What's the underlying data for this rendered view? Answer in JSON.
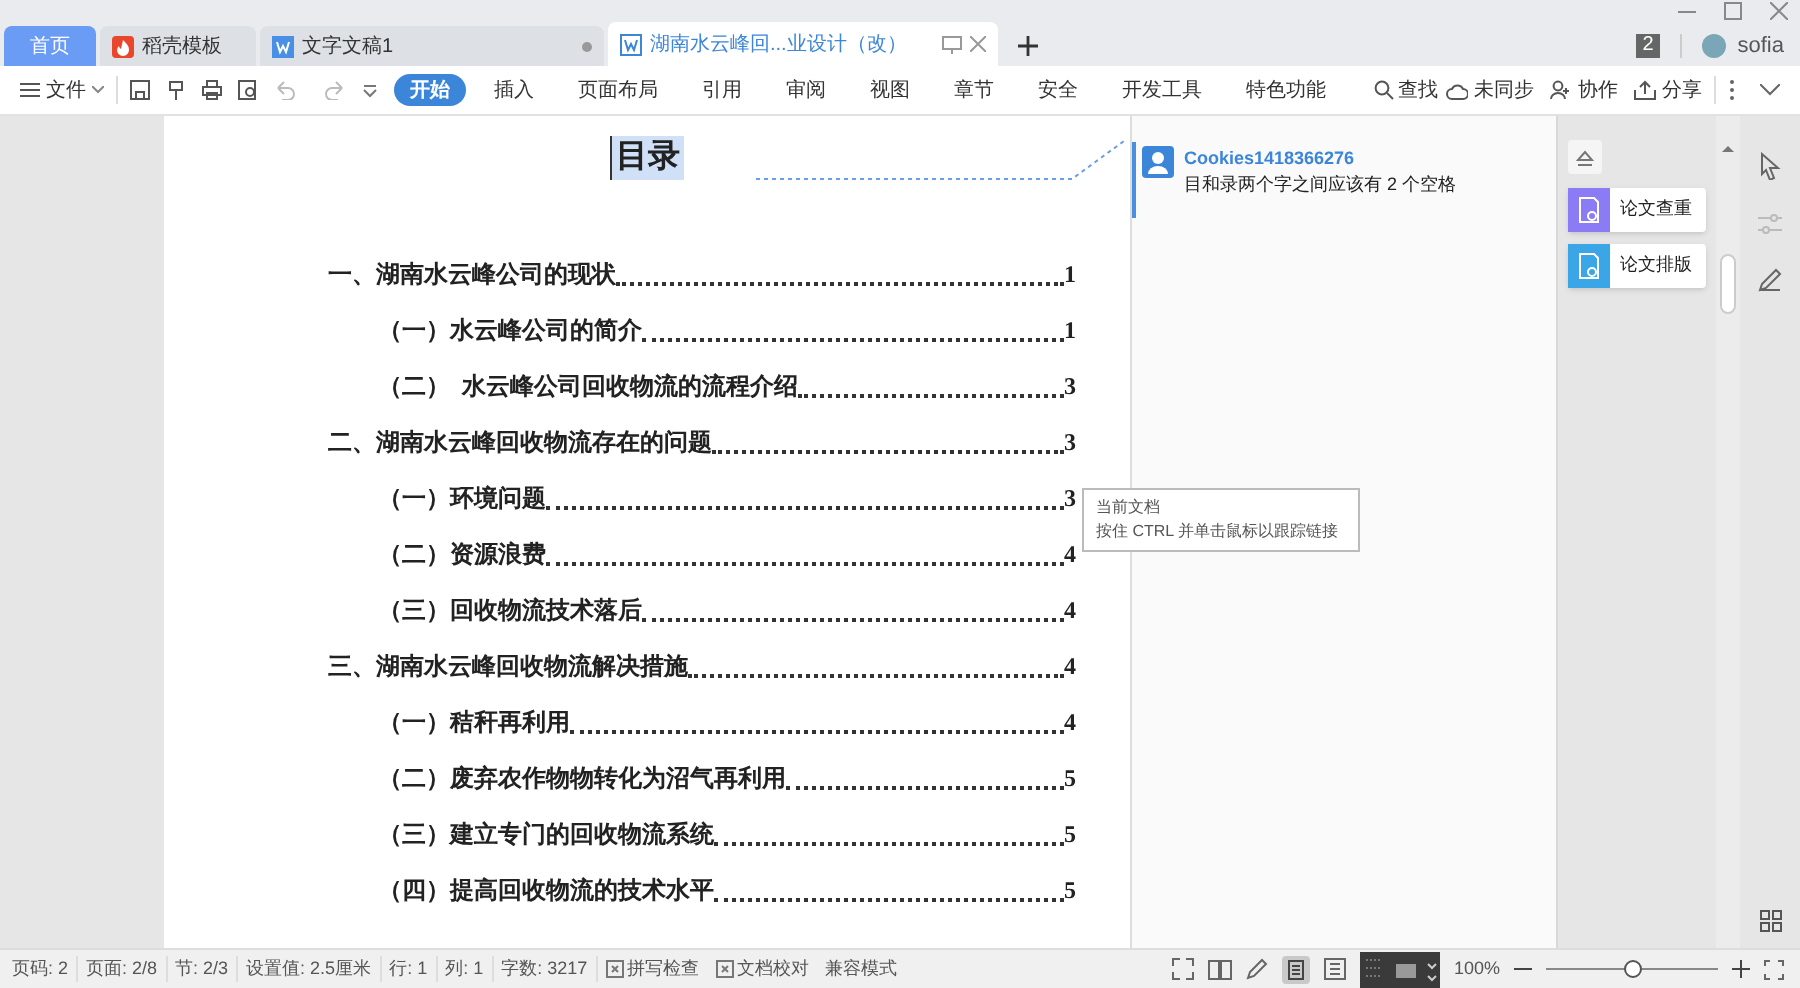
{
  "tabs": [
    {
      "kind": "home",
      "label": "首页",
      "selected": false
    },
    {
      "kind": "template",
      "label": "稻壳模板",
      "selected": false
    },
    {
      "kind": "doc",
      "label": "文字文稿1",
      "selected": false,
      "modified": true
    },
    {
      "kind": "doc",
      "label": "湖南水云峰回...业设计（改）",
      "selected": true,
      "modified": false
    }
  ],
  "window_badge": "2",
  "user": "sofia",
  "menu": {
    "file": "文件",
    "tabs": [
      {
        "label": "开始",
        "selected": true
      },
      {
        "label": "插入",
        "selected": false
      },
      {
        "label": "页面布局",
        "selected": false
      },
      {
        "label": "引用",
        "selected": false
      },
      {
        "label": "审阅",
        "selected": false
      },
      {
        "label": "视图",
        "selected": false
      },
      {
        "label": "章节",
        "selected": false
      },
      {
        "label": "安全",
        "selected": false
      },
      {
        "label": "开发工具",
        "selected": false
      },
      {
        "label": "特色功能",
        "selected": false
      }
    ],
    "search": "查找",
    "actions": [
      {
        "kind": "cloud",
        "label": "未同步"
      },
      {
        "kind": "people",
        "label": "协作"
      },
      {
        "kind": "share",
        "label": "分享"
      }
    ]
  },
  "document": {
    "title": "目录",
    "toc": [
      {
        "title": "一、湖南水云峰公司的现状",
        "page": "1",
        "children": [
          {
            "title": "（一）水云峰公司的简介",
            "page": "1"
          },
          {
            "title": "（二）  水云峰公司回收物流的流程介绍",
            "page": "3"
          }
        ]
      },
      {
        "title": "二、湖南水云峰回收物流存在的问题",
        "page": "3",
        "children": [
          {
            "title": "（一）环境问题",
            "page": "3"
          },
          {
            "title": "（二）资源浪费",
            "page": "4"
          },
          {
            "title": "（三）回收物流技术落后",
            "page": "4"
          }
        ]
      },
      {
        "title": "三、湖南水云峰回收物流解决措施",
        "page": "4",
        "children": [
          {
            "title": "（一）秸秆再利用",
            "page": "4"
          },
          {
            "title": "（二）废弃农作物物转化为沼气再利用",
            "page": "5"
          },
          {
            "title": "（三）建立专门的回收物流系统",
            "page": "5"
          },
          {
            "title": "（四）提高回收物流的技术水平",
            "page": "5"
          }
        ]
      }
    ]
  },
  "tooltip": {
    "title": "当前文档",
    "text": "按住 CTRL 并单击鼠标以跟踪链接"
  },
  "comment": {
    "author": "Cookies1418366276",
    "text": "目和录两个字之间应该有 2 个空格"
  },
  "side_tools": [
    {
      "label": "论文查重",
      "color": "#8b7cf6"
    },
    {
      "label": "论文排版",
      "color": "#3aa6e8"
    }
  ],
  "status": [
    "页码: 2",
    "页面: 2/8",
    "节: 2/3",
    "设置值: 2.5厘米",
    "行: 1",
    "列: 1",
    "字数: 3217"
  ],
  "status_toggles": [
    {
      "label": "拼写检查",
      "checked": false
    },
    {
      "label": "文档校对",
      "checked": false
    }
  ],
  "compat_mode": "兼容模式",
  "zoom": {
    "reading": "100%",
    "level": 0.5
  }
}
